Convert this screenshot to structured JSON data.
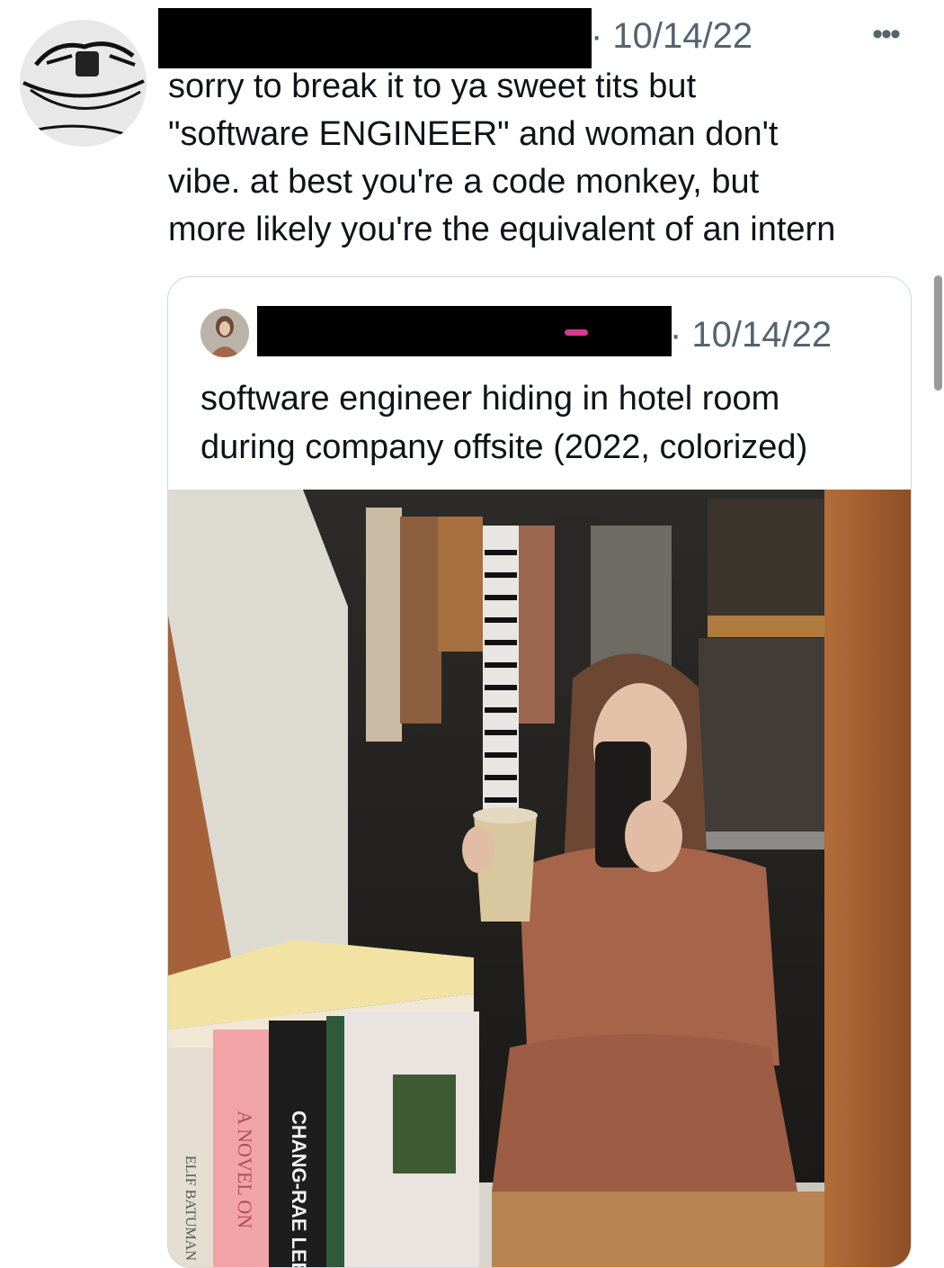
{
  "tweet": {
    "date": "· 10/14/22",
    "more_label": "•••",
    "text": "sorry to break it to ya sweet tits but\n\"software ENGINEER\" and woman don't\nvibe. at best you're a code monkey, but\nmore likely you're the equivalent of an intern"
  },
  "quote": {
    "date": "· 10/14/22",
    "text": "software engineer hiding in hotel room\nduring company offsite (2022, colorized)"
  },
  "photo": {
    "book_spines": [
      "ELIF BATUMAN",
      "A NOVEL ON",
      "CHANG-RAE LEE"
    ]
  },
  "colors": {
    "meta_gray": "#536471",
    "border": "#cfd9de",
    "redaction": "#000000"
  }
}
